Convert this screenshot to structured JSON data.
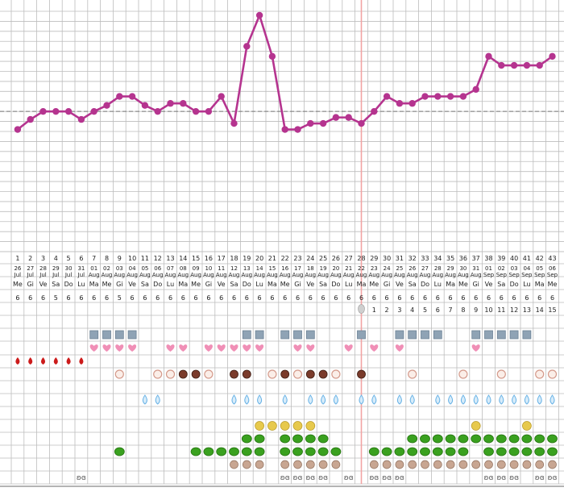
{
  "chart_data": {
    "type": "line",
    "title": "",
    "xlabel": "",
    "ylabel": "",
    "grid": true,
    "ylim": [
      0,
      24
    ],
    "coverline": 14.0,
    "marker_day": 28,
    "cycle_days": [
      1,
      2,
      3,
      4,
      5,
      6,
      7,
      8,
      9,
      10,
      11,
      12,
      13,
      14,
      15,
      16,
      17,
      18,
      19,
      20,
      21,
      22,
      23,
      24,
      25,
      26,
      27,
      28,
      29,
      30,
      31,
      32,
      33,
      34,
      35,
      36,
      37,
      38,
      39,
      40,
      41,
      42,
      43
    ],
    "dates_day": [
      "26",
      "27",
      "28",
      "29",
      "30",
      "31",
      "01",
      "02",
      "03",
      "04",
      "05",
      "06",
      "07",
      "08",
      "09",
      "10",
      "11",
      "12",
      "13",
      "14",
      "15",
      "16",
      "17",
      "18",
      "19",
      "20",
      "21",
      "22",
      "23",
      "24",
      "25",
      "26",
      "27",
      "28",
      "29",
      "30",
      "31",
      "01",
      "02",
      "03",
      "04",
      "05",
      "06"
    ],
    "dates_month": [
      "Jul",
      "Jul",
      "Jul",
      "Jul",
      "Jul",
      "Jul",
      "Aug",
      "Aug",
      "Aug",
      "Aug",
      "Aug",
      "Aug",
      "Aug",
      "Aug",
      "Aug",
      "Aug",
      "Aug",
      "Aug",
      "Aug",
      "Aug",
      "Aug",
      "Aug",
      "Aug",
      "Aug",
      "Aug",
      "Aug",
      "Aug",
      "Aug",
      "Aug",
      "Aug",
      "Aug",
      "Aug",
      "Aug",
      "Aug",
      "Aug",
      "Aug",
      "Aug",
      "Sep",
      "Sep",
      "Sep",
      "Sep",
      "Sep",
      "Sep"
    ],
    "weekdays": [
      "Me",
      "Gi",
      "Ve",
      "Sa",
      "Do",
      "Lu",
      "Ma",
      "Me",
      "Gi",
      "Ve",
      "Sa",
      "Do",
      "Lu",
      "Ma",
      "Me",
      "Gi",
      "Ve",
      "Sa",
      "Do",
      "Lu",
      "Ma",
      "Me",
      "Gi",
      "Ve",
      "Sa",
      "Do",
      "Lu",
      "Ma",
      "Me",
      "Gi",
      "Ve",
      "Sa",
      "Do",
      "Lu",
      "Ma",
      "Me",
      "Gi",
      "Ve",
      "Sa",
      "Do",
      "Lu",
      "Ma",
      "Me"
    ],
    "row_six": [
      "6",
      "6",
      "6",
      "5",
      "6",
      "6",
      "6",
      "6",
      "5",
      "6",
      "6",
      "6",
      "6",
      "6",
      "6",
      "6",
      "6",
      "6",
      "6",
      "6",
      "6",
      "6",
      "6",
      "6",
      "6",
      "6",
      "6",
      "6",
      "6",
      "6",
      "6",
      "6",
      "6",
      "6",
      "6",
      "6",
      "6",
      "6",
      "6",
      "6",
      "6",
      "6",
      "6"
    ],
    "dpo": [
      "",
      "",
      "",
      "",
      "",
      "",
      "",
      "",
      "",
      "",
      "",
      "",
      "",
      "",
      "",
      "",
      "",
      "",
      "",
      "",
      "",
      "",
      "",
      "",
      "",
      "",
      "",
      "",
      "1",
      "2",
      "3",
      "4",
      "5",
      "6",
      "7",
      "8",
      "9",
      "10",
      "11",
      "12",
      "13",
      "14",
      "15"
    ],
    "series": [
      {
        "color": "#b5348f",
        "values": [
          12.2,
          13.2,
          14.0,
          14.0,
          14.0,
          13.2,
          14.0,
          14.6,
          15.5,
          15.5,
          14.6,
          14.0,
          14.8,
          14.8,
          14.0,
          14.0,
          15.5,
          12.8,
          20.5,
          23.6,
          19.5,
          12.2,
          12.2,
          12.8,
          12.8,
          13.4,
          13.4,
          12.8,
          14.0,
          15.5,
          14.8,
          14.8,
          15.5,
          15.5,
          15.5,
          15.5,
          16.2,
          19.5,
          18.6,
          18.6,
          18.6,
          18.6,
          19.5
        ]
      }
    ],
    "symbol_rows": {
      "ovulation_test": [
        28
      ],
      "symptom_box": [
        7,
        8,
        9,
        10,
        19,
        20,
        22,
        23,
        24,
        28,
        31,
        32,
        33,
        34,
        37,
        38,
        39,
        40,
        41
      ],
      "heart": [
        7,
        8,
        9,
        10,
        13,
        14,
        16,
        17,
        18,
        19,
        20,
        23,
        24,
        27,
        29,
        31,
        37
      ],
      "bleeding": [
        1,
        2,
        3,
        4,
        5,
        6
      ],
      "mucus_a": [
        9,
        12,
        13,
        16,
        21,
        23,
        26,
        32,
        36,
        39,
        42,
        43
      ],
      "mucus_b": [
        14,
        15,
        18,
        19,
        22,
        24,
        25,
        28
      ],
      "drop": [
        11,
        12,
        18,
        19,
        20,
        22,
        24,
        25,
        26,
        28,
        29,
        31,
        32,
        34,
        35,
        36,
        37,
        38,
        39,
        40,
        41,
        42,
        43
      ],
      "face": [
        20,
        21,
        22,
        23,
        24,
        37,
        41
      ],
      "frog_top": [
        19,
        20,
        22,
        23,
        24,
        25,
        32,
        33,
        34,
        35,
        36,
        37,
        38,
        39,
        40,
        41,
        42,
        43
      ],
      "frog_bottom": [
        9,
        15,
        16,
        17,
        18,
        19,
        20,
        22,
        23,
        24,
        25,
        26,
        29,
        30,
        31,
        32,
        33,
        34,
        35,
        36,
        38,
        39,
        40,
        41,
        42,
        43
      ],
      "round": [
        18,
        19,
        20,
        22,
        23,
        24,
        25,
        26,
        29,
        30,
        31,
        32,
        33,
        34,
        35,
        36,
        37,
        38,
        39,
        40,
        41,
        42,
        43
      ],
      "bra": [
        6,
        22,
        23,
        24,
        25,
        27,
        29,
        30,
        31,
        38,
        39,
        40,
        42,
        43
      ]
    },
    "symbol_colors": {
      "ovulation_test": "#cfcfcf",
      "symptom_box": "#8fa3b5",
      "heart": "#f08fb6",
      "bleeding": "#cc1b1b",
      "mucus_a": "#d49a8b",
      "mucus_b": "#7a3b2b",
      "drop": "#6ab3e6",
      "face": "#e7c94c",
      "frog_top": "#3aa11f",
      "frog_bottom": "#3aa11f",
      "round": "#c8a692",
      "bra": "#555555"
    }
  }
}
